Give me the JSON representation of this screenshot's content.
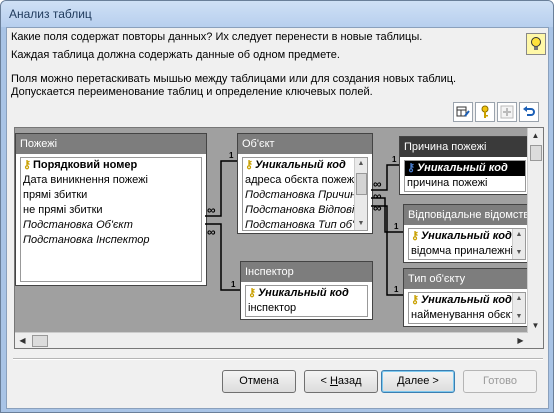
{
  "window": {
    "title": "Анализ таблиц"
  },
  "prompt": {
    "line1": "Какие поля содержат повторы данных? Их следует перенести в новые таблицы.",
    "line2": "Каждая таблица должна содержать данные об одном предмете.",
    "line3": "Поля можно перетаскивать мышью между таблицами или для создания новых таблиц.",
    "line4": "Допускается переименование таблиц и определение ключевых полей."
  },
  "icons": {
    "tip": "lightbulb-icon",
    "toolbar": [
      "rename-table-icon",
      "set-key-icon",
      "add-table-icon",
      "undo-icon"
    ]
  },
  "tables": {
    "pozhezhi": {
      "title": "Пожежі",
      "rows": [
        "Порядковий номер",
        "Дата виникнення пожежі",
        "прямі збитки",
        "не прямі збитки",
        "Подстановка Об'єкт",
        "Подстановка Інспектор"
      ]
    },
    "obekt": {
      "title": "Об'єкт",
      "rows": [
        "Уникальный код",
        "адреса обєкта пожежі",
        "Подстановка Причина",
        "Подстановка Відповід",
        "Подстановка Тип об'є"
      ]
    },
    "inspektor": {
      "title": "Інспектор",
      "rows": [
        "Уникальный код",
        "інспектор"
      ]
    },
    "prychyna": {
      "title": "Причина пожежі",
      "rows": [
        "Уникальный код",
        "причина пожежі"
      ]
    },
    "vidpovidalne": {
      "title": "Відповідальне відомство",
      "rows": [
        "Уникальный код",
        "відомча приналежніст"
      ]
    },
    "typ": {
      "title": "Тип об'єкту",
      "rows": [
        "Уникальный код",
        "найменування обєкта"
      ]
    }
  },
  "relations": {
    "one": "1",
    "many": "∞"
  },
  "buttons": {
    "cancel": "Отмена",
    "back_prefix": "< ",
    "back_key": "Н",
    "back_rest": "азад",
    "next_key": "Д",
    "next_rest": "алее >",
    "finish": "Готово"
  },
  "colors": {
    "accent": "#3c7fb1",
    "titlebar": "#b7cfee",
    "active_header": "#3a3a3a",
    "inactive_header": "#7d7d7d"
  }
}
